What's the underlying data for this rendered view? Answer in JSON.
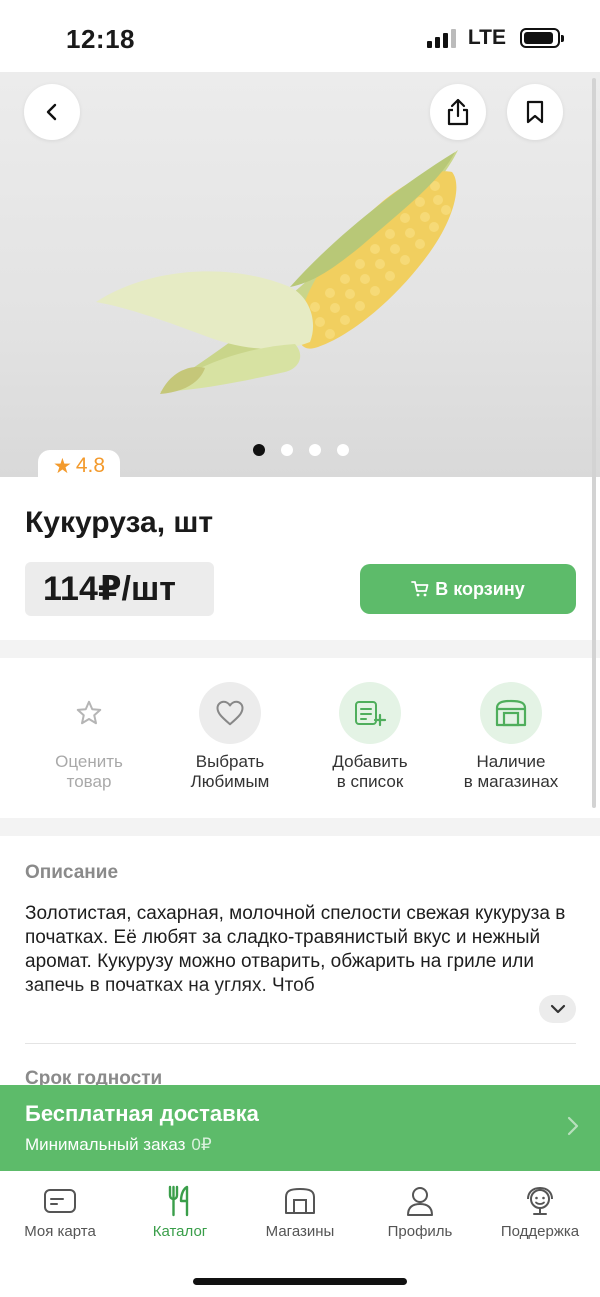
{
  "status": {
    "time": "12:18",
    "network": "LTE"
  },
  "colors": {
    "accent": "#5dbb6a",
    "rating": "#f39a2c"
  },
  "product": {
    "rating": "4.8",
    "title": "Кукуруза, шт",
    "price": "114₽/шт",
    "cart_label": "В корзину",
    "image_dots": {
      "count": 4,
      "active": 0
    }
  },
  "actions": [
    {
      "label": "Оценить\nтовар",
      "icon": "star-icon"
    },
    {
      "label": "Выбрать\nЛюбимым",
      "icon": "heart-icon"
    },
    {
      "label": "Добавить\nв список",
      "icon": "add-list-icon"
    },
    {
      "label": "Наличие\nв магазинах",
      "icon": "store-icon"
    }
  ],
  "description": {
    "heading": "Описание",
    "text": "Золотистая, сахарная, молочной спелости свежая кукуруза в початках. Её любят за сладко-травянистый вкус и нежный аромат. Кукурузу можно отварить, обжарить на гриле или запечь в початках на углях. Чтоб"
  },
  "shelf_life": {
    "heading": "Срок годности"
  },
  "delivery": {
    "title": "Бесплатная доставка",
    "min_order_label": "Минимальный заказ",
    "min_order_value": "0₽"
  },
  "tabs": [
    {
      "label": "Моя карта",
      "icon": "card-icon"
    },
    {
      "label": "Каталог",
      "icon": "catalog-icon",
      "active": true
    },
    {
      "label": "Магазины",
      "icon": "shop-icon"
    },
    {
      "label": "Профиль",
      "icon": "profile-icon"
    },
    {
      "label": "Поддержка",
      "icon": "support-icon"
    }
  ]
}
